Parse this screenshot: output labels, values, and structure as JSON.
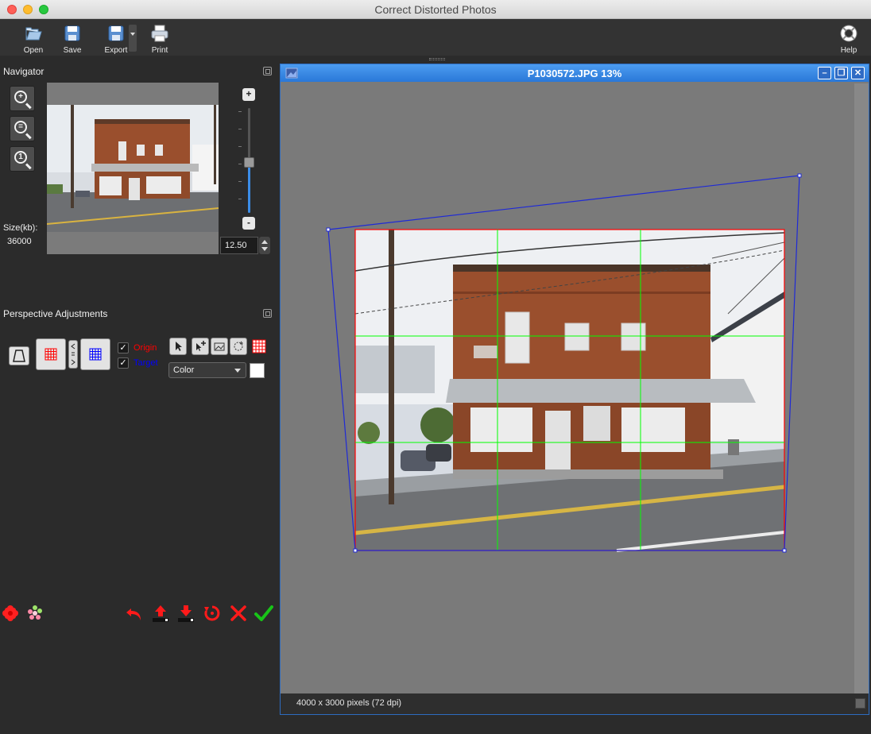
{
  "window": {
    "title": "Correct Distorted Photos"
  },
  "toolbar": {
    "open": "Open",
    "save": "Save",
    "export": "Export",
    "print": "Print",
    "help": "Help"
  },
  "navigator": {
    "title": "Navigator",
    "size_label": "Size(kb):",
    "size_value": "36000",
    "zoom_value": "12.50",
    "slider_plus": "+",
    "slider_minus": "-"
  },
  "perspective": {
    "title": "Perspective Adjustments",
    "origin_label": "Origin",
    "target_label": "Target",
    "mode_select": "Color",
    "colors": {
      "origin": "#ff0000",
      "target": "#0000ff",
      "swatch": "#ffffff"
    }
  },
  "image_window": {
    "title": "P1030572.JPG 13%",
    "status": "4000 x 3000 pixels (72 dpi)",
    "minimize": "–",
    "restore": "❐",
    "close": "✕"
  },
  "colors": {
    "accent": "#2a78d8",
    "origin_grid": "#ff0000",
    "target_grid": "#0000ff",
    "guide_lines": "#00ff00"
  }
}
